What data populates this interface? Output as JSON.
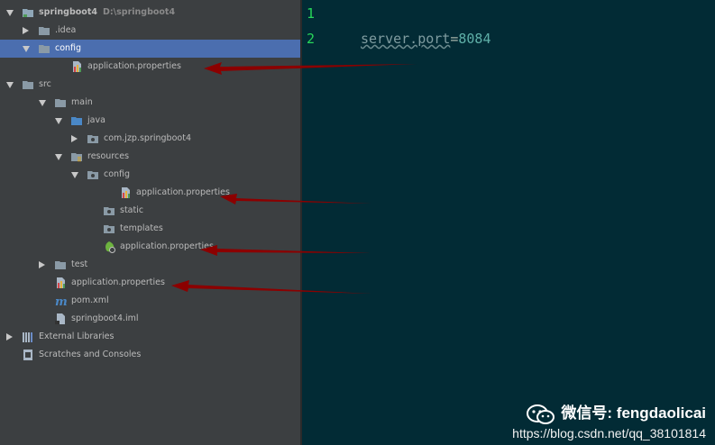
{
  "tree": {
    "items": [
      {
        "label": "springboot4",
        "sub": "D:\\springboot4",
        "depth": 0,
        "toggle": "down",
        "icon": "module-folder-icon",
        "selected": false
      },
      {
        "label": ".idea",
        "depth": 1,
        "toggle": "right",
        "icon": "folder-icon",
        "selected": false
      },
      {
        "label": "config",
        "depth": 1,
        "toggle": "down",
        "icon": "folder-icon",
        "selected": true
      },
      {
        "label": "application.properties",
        "depth": 3,
        "toggle": "",
        "icon": "properties-file-icon",
        "selected": false
      },
      {
        "label": "src",
        "depth": 0.0,
        "toggle": "down",
        "icon": "folder-icon",
        "selected": false
      },
      {
        "label": "main",
        "depth": 2,
        "toggle": "down",
        "icon": "folder-icon",
        "selected": false
      },
      {
        "label": "java",
        "depth": 3,
        "toggle": "down",
        "icon": "source-folder-icon",
        "selected": false
      },
      {
        "label": "com.jzp.springboot4",
        "depth": 4,
        "toggle": "right",
        "icon": "package-icon",
        "selected": false
      },
      {
        "label": "resources",
        "depth": 3,
        "toggle": "down",
        "icon": "resources-folder-icon",
        "selected": false
      },
      {
        "label": "config",
        "depth": 4,
        "toggle": "down",
        "icon": "package-icon",
        "selected": false
      },
      {
        "label": "application.properties",
        "depth": 6,
        "toggle": "",
        "icon": "properties-file-icon",
        "selected": false
      },
      {
        "label": "static",
        "depth": 5,
        "toggle": "",
        "icon": "package-icon",
        "selected": false
      },
      {
        "label": "templates",
        "depth": 5,
        "toggle": "",
        "icon": "package-icon",
        "selected": false
      },
      {
        "label": "application.properties",
        "depth": 5,
        "toggle": "",
        "icon": "spring-properties-icon",
        "selected": false
      },
      {
        "label": "test",
        "depth": 2,
        "toggle": "right",
        "icon": "folder-icon",
        "selected": false
      },
      {
        "label": "application.properties",
        "depth": 2,
        "toggle": "",
        "icon": "properties-file-icon",
        "selected": false
      },
      {
        "label": "pom.xml",
        "depth": 2,
        "toggle": "",
        "icon": "maven-icon",
        "selected": false
      },
      {
        "label": "springboot4.iml",
        "depth": 2,
        "toggle": "",
        "icon": "iml-file-icon",
        "selected": false
      },
      {
        "label": "External Libraries",
        "depth": 0,
        "toggle": "right",
        "icon": "libraries-icon",
        "selected": false
      },
      {
        "label": "Scratches and Consoles",
        "depth": 0,
        "toggle": "",
        "icon": "scratches-icon",
        "selected": false
      }
    ]
  },
  "editor": {
    "lines": [
      {
        "num": "1",
        "key": "",
        "eq": "",
        "value": ""
      },
      {
        "num": "2",
        "key": "server.port",
        "eq": "=",
        "value": "8084"
      }
    ]
  },
  "watermark": {
    "line1": "微信号: fengdaolicai",
    "line2": "https://blog.csdn.net/qq_38101814"
  },
  "colors": {
    "tree_bg": "#3c3f41",
    "selection": "#4b6eaf",
    "editor_bg": "#022b35",
    "line_number": "#27d75a",
    "arrow": "#8b0000"
  }
}
